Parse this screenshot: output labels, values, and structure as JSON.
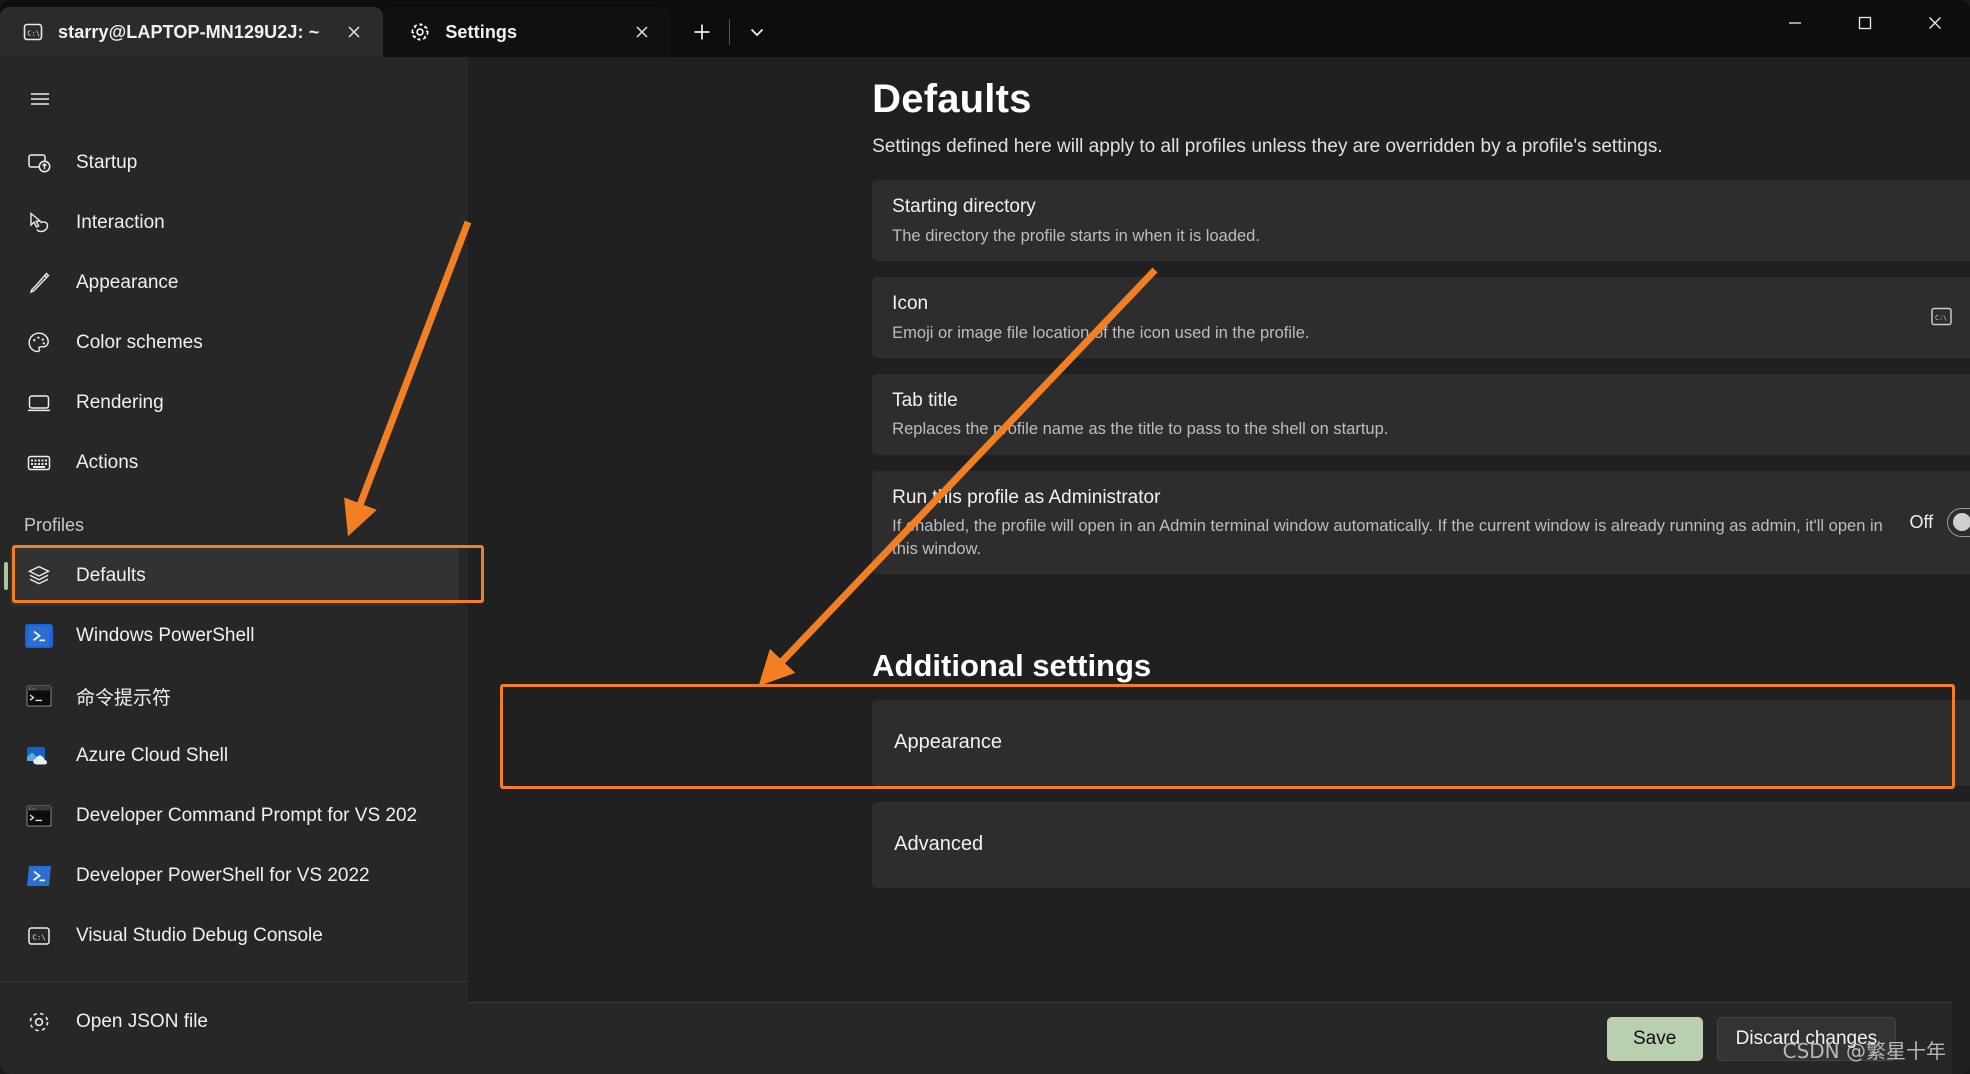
{
  "window": {
    "controls": {
      "minimize": "—",
      "maximize": "□",
      "close": "✕"
    }
  },
  "tabs": [
    {
      "id": "terminal",
      "title": "starry@LAPTOP-MN129U2J: ~",
      "icon": "console-icon",
      "active": false,
      "close": "✕"
    },
    {
      "id": "settings",
      "title": "Settings",
      "icon": "gear-icon",
      "active": true,
      "close": "✕"
    }
  ],
  "tabstrip": {
    "new_tab": "+",
    "dropdown": "⌄"
  },
  "sidebar": {
    "hamburger": "☰",
    "items": [
      {
        "label": "Startup",
        "icon": "startup-icon"
      },
      {
        "label": "Interaction",
        "icon": "cursor-icon"
      },
      {
        "label": "Appearance",
        "icon": "paintbrush-icon"
      },
      {
        "label": "Color schemes",
        "icon": "palette-icon"
      },
      {
        "label": "Rendering",
        "icon": "monitor-icon"
      },
      {
        "label": "Actions",
        "icon": "keyboard-icon"
      }
    ],
    "profiles_header": "Profiles",
    "profiles": [
      {
        "label": "Defaults",
        "icon": "layers-icon",
        "selected": true
      },
      {
        "label": "Windows PowerShell",
        "icon": "powershell-icon",
        "selected": false
      },
      {
        "label": "命令提示符",
        "icon": "cmd-icon",
        "selected": false
      },
      {
        "label": "Azure Cloud Shell",
        "icon": "azure-icon",
        "selected": false
      },
      {
        "label": "Developer Command Prompt for VS 202",
        "icon": "cmd-icon",
        "selected": false
      },
      {
        "label": "Developer PowerShell for VS 2022",
        "icon": "powershell-icon",
        "selected": false
      },
      {
        "label": "Visual Studio Debug Console",
        "icon": "console-icon",
        "selected": false
      }
    ],
    "open_json": {
      "label": "Open JSON file",
      "icon": "gear-icon"
    }
  },
  "main": {
    "title": "Defaults",
    "subtitle": "Settings defined here will apply to all profiles unless they are overridden by a profile's settings.",
    "cards": [
      {
        "title": "Starting directory",
        "desc": "The directory the profile starts in when it is loaded.",
        "control": "chevron",
        "chevron": "⌄"
      },
      {
        "title": "Icon",
        "desc": "Emoji or image file location of the icon used in the profile.",
        "control": "icon-preview-chevron",
        "preview_icon": "console-icon",
        "chevron": "⌄"
      },
      {
        "title": "Tab title",
        "desc": "Replaces the profile name as the title to pass to the shell on startup.",
        "control": "chevron",
        "chevron": "⌄"
      },
      {
        "title": "Run this profile as Administrator",
        "desc": "If enabled, the profile will open in an Admin terminal window automatically. If the current window is already running as admin, it'll open in this window.",
        "control": "toggle",
        "toggle_label": "Off",
        "toggle_on": false
      }
    ],
    "additional_settings_title": "Additional settings",
    "nav_cards": [
      {
        "label": "Appearance",
        "chevron": "›",
        "highlighted": true
      },
      {
        "label": "Advanced",
        "chevron": "›",
        "highlighted": false
      }
    ]
  },
  "command_bar": {
    "save": "Save",
    "discard": "Discard changes"
  },
  "watermark": "CSDN @繁星十年",
  "colors": {
    "accent_annotation": "#f28022",
    "save_button": "#b8d0b0",
    "selection_bar": "#a9c5a0",
    "sidebar_bg": "#272727",
    "main_bg": "#202020",
    "card_bg": "#2d2d2d",
    "titlebar_bg": "#0d0d0d"
  }
}
